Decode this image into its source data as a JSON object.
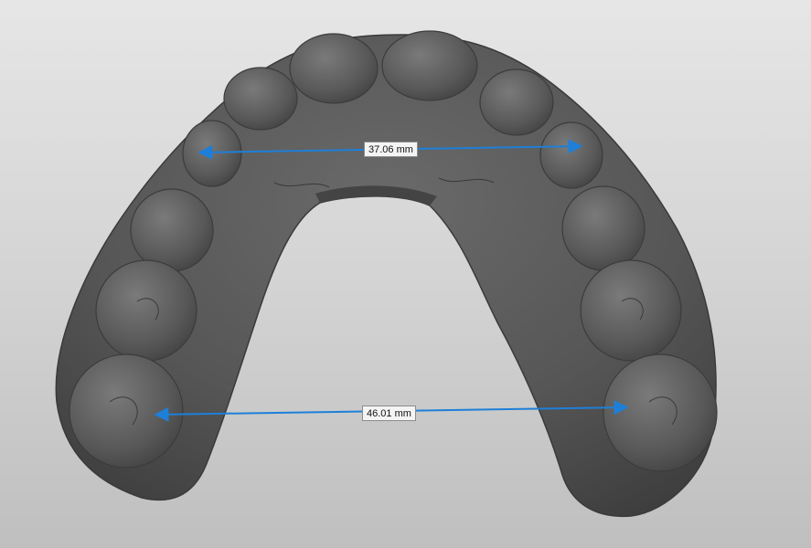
{
  "view": {
    "background_top": "#e6e6e6",
    "background_bottom": "#bfbfbf",
    "model_color": "#5a5a5a",
    "measure_color": "#1e7fd8"
  },
  "measurements": [
    {
      "label": "37.06 mm"
    },
    {
      "label": "46.01 mm"
    }
  ]
}
